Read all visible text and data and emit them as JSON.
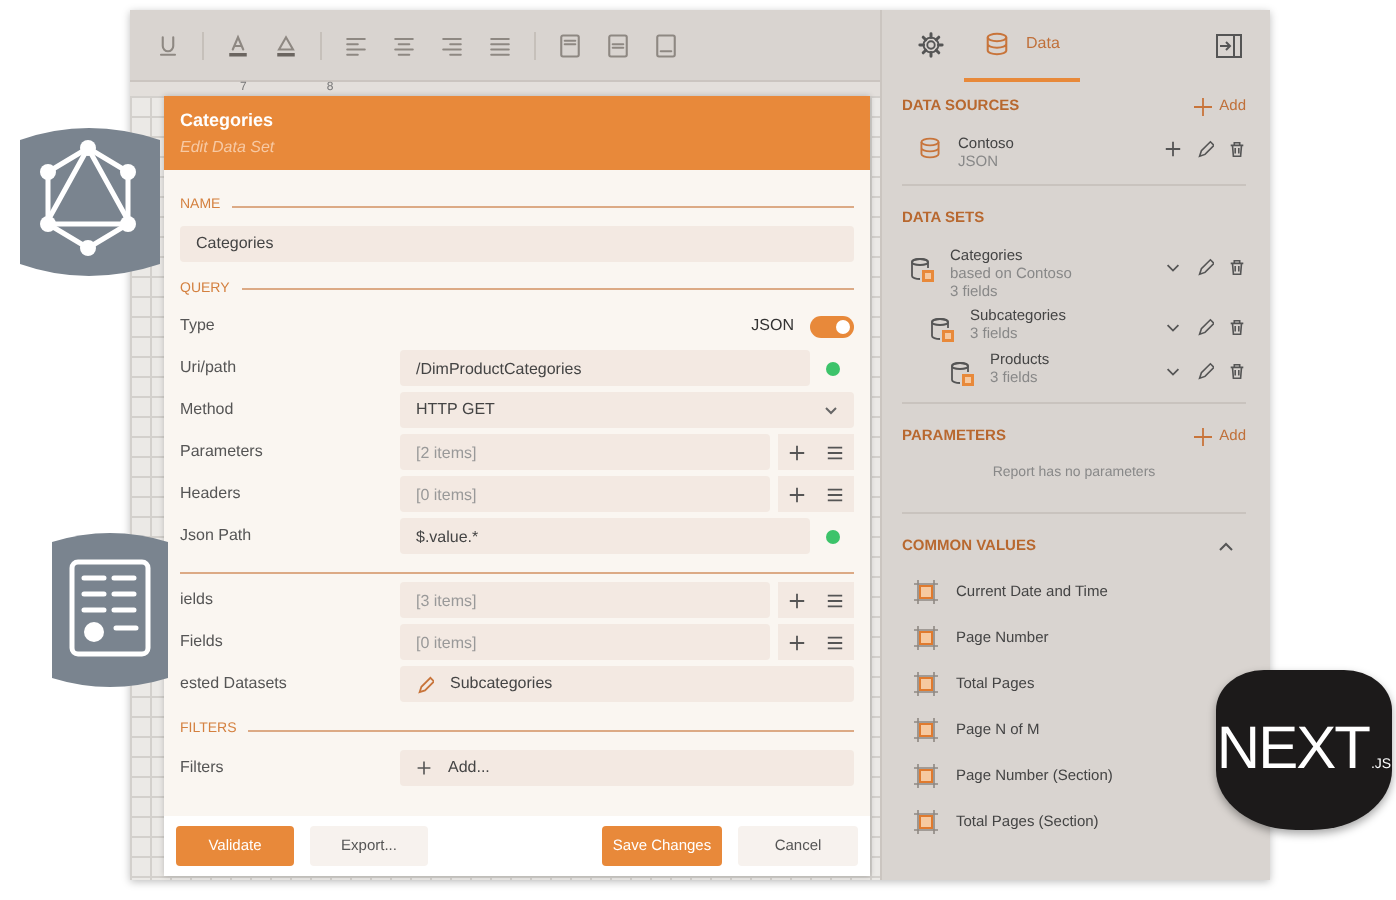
{
  "toolbar": [
    {
      "kind": "underline"
    },
    {
      "kind": "font_color"
    },
    {
      "kind": "highlight"
    },
    {
      "kind": "align_left"
    },
    {
      "kind": "align_center"
    },
    {
      "kind": "align_right"
    },
    {
      "kind": "justify"
    },
    {
      "kind": "page_header"
    },
    {
      "kind": "page_body"
    },
    {
      "kind": "page_footer"
    }
  ],
  "ruler": {
    "labels": [
      "7",
      "8"
    ]
  },
  "dialog": {
    "title": "Categories",
    "subtitle": "Edit Data Set",
    "sections": [
      {
        "heading": "NAME",
        "rows": [
          {
            "kind": "name",
            "value": "Categories"
          }
        ]
      },
      {
        "heading": "QUERY",
        "rows": [
          {
            "kind": "toggle",
            "label": "Type",
            "text": "JSON",
            "on": true
          },
          {
            "kind": "status",
            "label": "Uri/path",
            "value": "/DimProductCategories",
            "valid": true
          },
          {
            "kind": "select",
            "label": "Method",
            "value": "HTTP GET"
          },
          {
            "kind": "list",
            "label": "Parameters",
            "placeholder": "[2 items]"
          },
          {
            "kind": "list",
            "label": "Headers",
            "placeholder": "[0 items]"
          },
          {
            "kind": "status",
            "label": "Json Path",
            "value": "$.value.*",
            "valid": true
          }
        ]
      },
      {
        "rows": [
          {
            "kind": "list",
            "label": "ields",
            "placeholder": "[3 items]"
          },
          {
            "kind": "list",
            "label": "Fields",
            "placeholder": "[0 items]"
          },
          {
            "kind": "link",
            "label": "ested Datasets",
            "value": "Subcategories"
          }
        ]
      },
      {
        "heading": "FILTERS",
        "rows": [
          {
            "kind": "add",
            "label": "Filters",
            "value": "Add..."
          }
        ]
      }
    ],
    "footer_left": [
      {
        "label": "Validate",
        "primary": true
      },
      {
        "label": "Export...",
        "primary": false
      }
    ],
    "footer_right": [
      {
        "label": "Save Changes",
        "primary": true
      },
      {
        "label": "Cancel",
        "primary": false
      }
    ]
  },
  "panel": {
    "tabs": [
      {
        "kind": "settings",
        "selected": false
      },
      {
        "kind": "data",
        "label": "Data",
        "selected": true
      }
    ],
    "data_sources": {
      "heading": "DATA SOURCES",
      "add": "Add",
      "items": [
        {
          "name": "Contoso",
          "details": [
            "JSON"
          ]
        }
      ]
    },
    "data_sets": {
      "heading": "DATA SETS",
      "items": [
        {
          "name": "Categories",
          "details": [
            "based on Contoso",
            "3 fields"
          ],
          "children": [
            {
              "name": "Subcategories",
              "details": [
                "3 fields"
              ],
              "children": [
                {
                  "name": "Products",
                  "details": [
                    "3 fields"
                  ]
                }
              ]
            }
          ]
        }
      ]
    },
    "parameters": {
      "heading": "PARAMETERS",
      "add": "Add",
      "empty_text": "Report has no parameters"
    },
    "common_values": {
      "heading": "COMMON VALUES",
      "expanded": true,
      "items": [
        "Current Date and Time",
        "Page Number",
        "Total Pages",
        "Page N of M",
        "Page Number (Section)",
        "Total Pages (Section)"
      ]
    }
  },
  "badges": [
    {
      "kind": "graphql"
    },
    {
      "kind": "report"
    },
    {
      "kind": "nextjs",
      "text": "NEXT",
      "suffix": ".JS"
    }
  ]
}
